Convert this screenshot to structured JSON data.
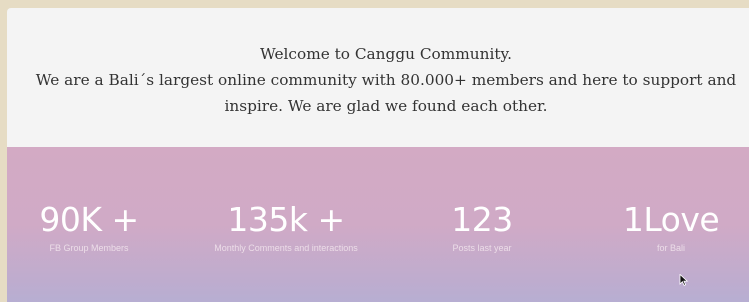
{
  "welcome": {
    "lines": [
      "Welcome to Canggu Community.",
      "We are a Bali´s largest online community with 80.000+ members and here to support and",
      "inspire. We are glad we found each other."
    ]
  },
  "stats": [
    {
      "value": "90K +",
      "label": "FB Group Members"
    },
    {
      "value": "135k +",
      "label": "Monthly Comments and interactions"
    },
    {
      "value": "123",
      "label": "Posts last year"
    },
    {
      "value": "1Love",
      "label": "for Bali"
    }
  ],
  "colors": {
    "welcome_bg": "#f4f4f4",
    "stats_gradient_top": "#d3aac4",
    "stats_gradient_bottom": "#b7aed2",
    "text_dark": "#333333"
  },
  "icons": {
    "cursor": "mouse-pointer-icon"
  }
}
